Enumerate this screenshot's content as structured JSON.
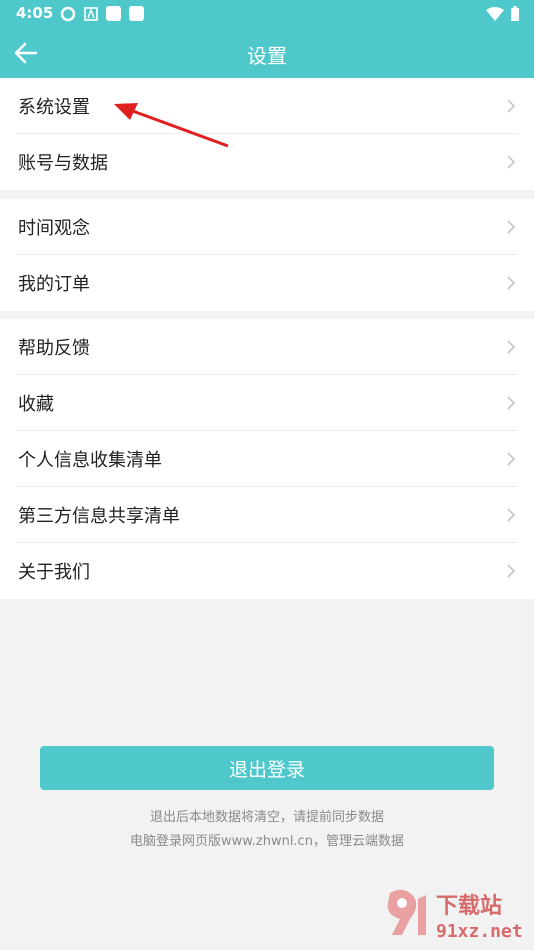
{
  "status_bar": {
    "time": "4:05"
  },
  "header": {
    "title": "设置"
  },
  "groups": [
    [
      {
        "label": "系统设置"
      },
      {
        "label": "账号与数据"
      }
    ],
    [
      {
        "label": "时间观念"
      },
      {
        "label": "我的订单"
      }
    ],
    [
      {
        "label": "帮助反馈"
      },
      {
        "label": "收藏"
      },
      {
        "label": "个人信息收集清单"
      },
      {
        "label": "第三方信息共享清单"
      },
      {
        "label": "关于我们"
      }
    ]
  ],
  "logout": {
    "label": "退出登录"
  },
  "hints": [
    "退出后本地数据将清空，请提前同步数据",
    "电脑登录网页版www.zhwnl.cn，管理云端数据"
  ],
  "watermark": {
    "brand": "下载站",
    "site": "91xz.net"
  },
  "colors": {
    "accent": "#4fc8cc",
    "annotation": "#e02020"
  }
}
